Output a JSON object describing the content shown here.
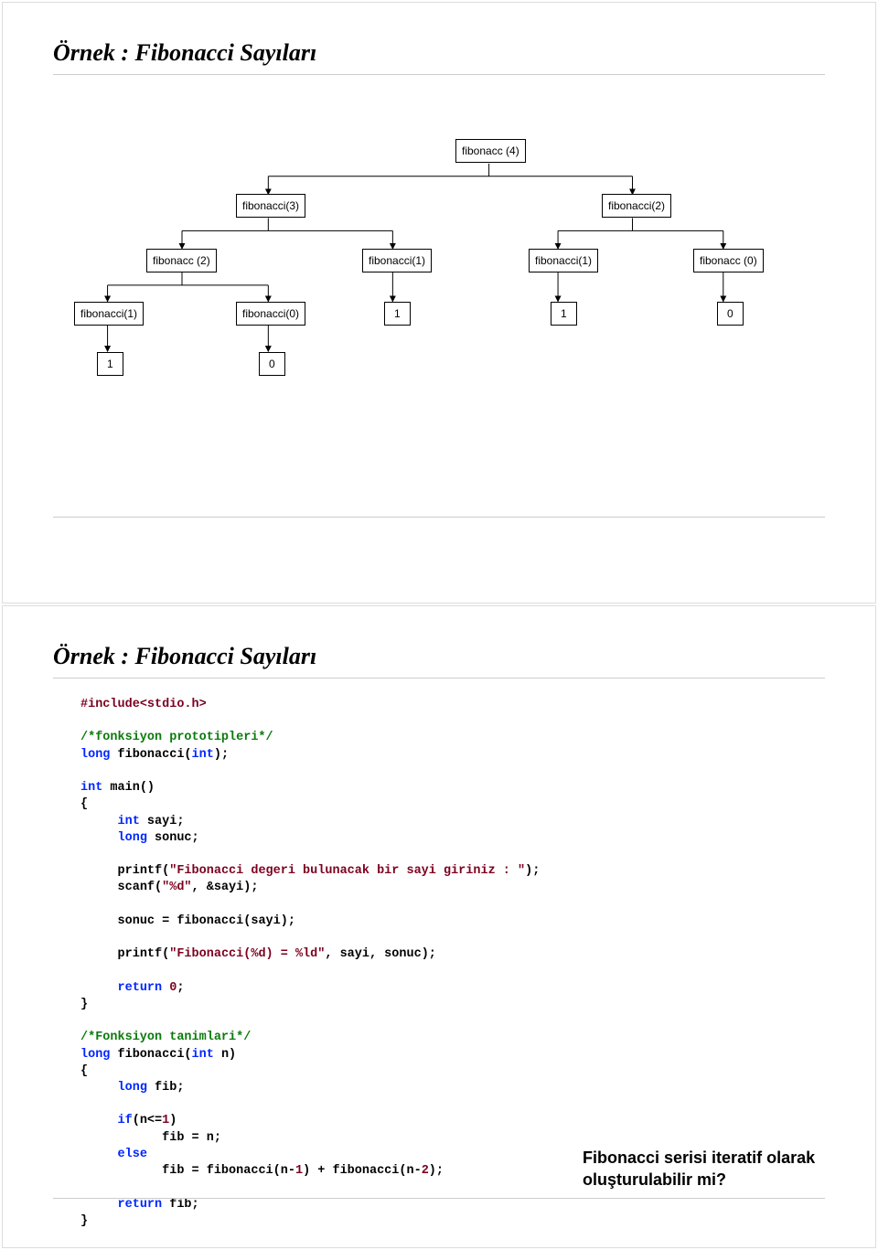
{
  "slide1": {
    "title": "Örnek : Fibonacci Sayıları",
    "nodes": {
      "f4": "fibonacc (4)",
      "f3": "fibonacci(3)",
      "f2a": "fibonacci(2)",
      "f2b": "fibonacc (2)",
      "f1a": "fibonacci(1)",
      "f1b": "fibonacci(1)",
      "f0a": "fibonacc (0)",
      "f1c": "fibonacci(1)",
      "f0b": "fibonacci(0)",
      "v1a": "1",
      "v1b": "1",
      "v0a": "0",
      "v1c": "1",
      "v0b": "0"
    }
  },
  "slide2": {
    "title": "Örnek : Fibonacci Sayıları",
    "question": "Fibonacci serisi iteratif olarak oluşturulabilir mi?",
    "code": {
      "l1_a": "#include",
      "l1_b": "<stdio.h>",
      "l3": "/*fonksiyon prototipleri*/",
      "l4_kw1": "long",
      "l4_t": " fibonacci(",
      "l4_kw2": "int",
      "l4_t2": ");",
      "l6_kw": "int",
      "l6_t": " main()",
      "l7": "{",
      "l8_kw": "int",
      "l8_t": " sayi;",
      "l9_kw": "long",
      "l9_t": " sonuc;",
      "l11_a": "printf(",
      "l11_s": "\"Fibonacci degeri bulunacak bir sayi giriniz : \"",
      "l11_b": ");",
      "l12_a": "scanf(",
      "l12_s": "\"%d\"",
      "l12_b": ", &sayi);",
      "l14": "sonuc = fibonacci(sayi);",
      "l16_a": "printf(",
      "l16_s": "\"Fibonacci(%d) = %ld\"",
      "l16_b": ", sayi, sonuc);",
      "l18_kw": "return",
      "l18_n": " 0",
      "l18_t": ";",
      "l19": "}",
      "l21": "/*Fonksiyon tanimlari*/",
      "l22_kw1": "long",
      "l22_t": " fibonacci(",
      "l22_kw2": "int",
      "l22_t2": " n)",
      "l23": "{",
      "l24_kw": "long",
      "l24_t": " fib;",
      "l26_kw": "if",
      "l26_t": "(n<=",
      "l26_n": "1",
      "l26_t2": ")",
      "l27": "fib = n;",
      "l28_kw": "else",
      "l29_a": "fib = fibonacci(n-",
      "l29_n1": "1",
      "l29_b": ") + fibonacci(n-",
      "l29_n2": "2",
      "l29_c": ");",
      "l31_kw": "return",
      "l31_t": " fib;",
      "l32": "}"
    }
  }
}
